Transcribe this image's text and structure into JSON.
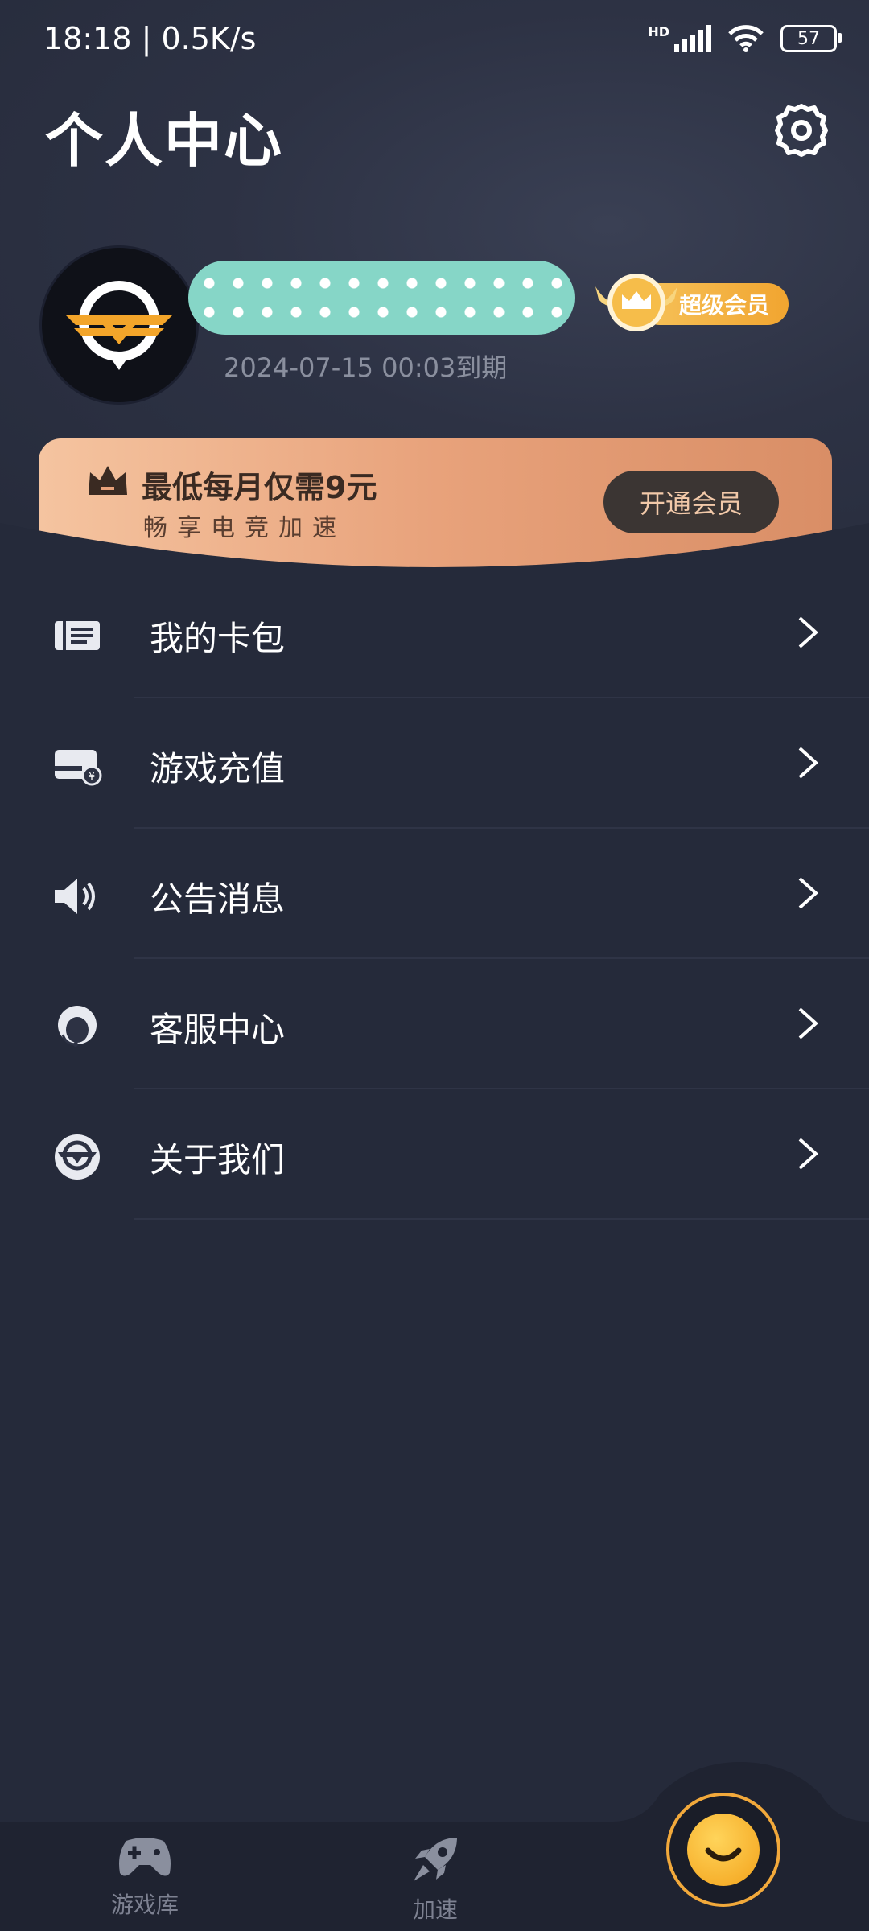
{
  "status_bar": {
    "time_speed": "18:18 | 0.5K/s",
    "network": "HD",
    "battery": "57"
  },
  "header": {
    "title": "个人中心"
  },
  "profile": {
    "vip_label": "超级会员",
    "expiry": "2024-07-15  00:03到期"
  },
  "promo": {
    "title": "最低每月仅需9元",
    "subtitle": "畅享电竞加速",
    "button": "开通会员"
  },
  "menu": {
    "items": [
      {
        "label": "我的卡包",
        "icon": "card-wallet-icon"
      },
      {
        "label": "游戏充值",
        "icon": "recharge-card-icon"
      },
      {
        "label": "公告消息",
        "icon": "speaker-icon"
      },
      {
        "label": "客服中心",
        "icon": "customer-service-icon"
      },
      {
        "label": "关于我们",
        "icon": "about-logo-icon"
      }
    ]
  },
  "bottom_nav": {
    "items": [
      {
        "label": "游戏库",
        "icon": "gamepad-icon"
      },
      {
        "label": "加速",
        "icon": "rocket-icon"
      },
      {
        "label": "",
        "icon": "smile-icon"
      }
    ]
  },
  "colors": {
    "background": "#252a3a",
    "accent": "#f2a93b",
    "vip_gold": "#f1a530",
    "promo_peach": "#e8a27b"
  }
}
